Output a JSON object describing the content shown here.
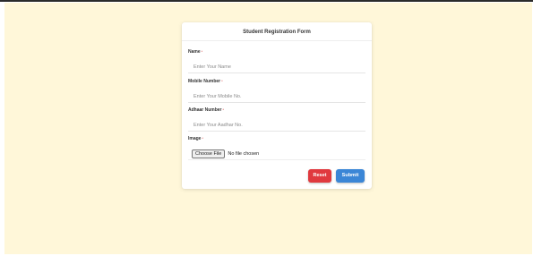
{
  "form": {
    "title": "Student Registration Form",
    "required_marker": "*",
    "fields": [
      {
        "label": "Name",
        "placeholder": "Enter Your Name",
        "value": ""
      },
      {
        "label": "Mobile Number",
        "placeholder": "Enter Your Mobile No.",
        "value": ""
      },
      {
        "label": "Adhaar Number",
        "placeholder": "Enter Your Aadhar No.",
        "value": ""
      }
    ],
    "image": {
      "label": "Image",
      "button_label": "Choose File",
      "status": "No file chosen"
    },
    "reset_label": "Reset",
    "submit_label": "Submit"
  },
  "colors": {
    "background": "#fff7d9",
    "reset": "#e0393e",
    "submit": "#3b86d6"
  }
}
